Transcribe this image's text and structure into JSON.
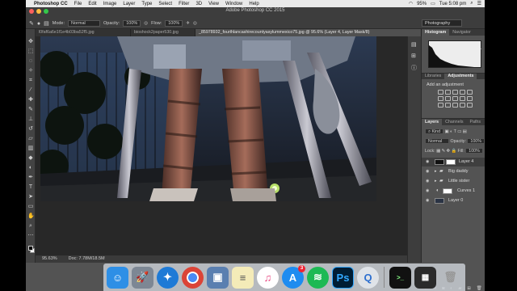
{
  "menubar": {
    "app_name": "Photoshop CC",
    "items": [
      "File",
      "Edit",
      "Image",
      "Layer",
      "Type",
      "Select",
      "Filter",
      "3D",
      "View",
      "Window",
      "Help"
    ],
    "battery": "95%",
    "time": "Tue 5:08 pm"
  },
  "window": {
    "title": "Adobe Photoshop CC 2015"
  },
  "options": {
    "mode_label": "Mode:",
    "mode_value": "Normal",
    "opacity_label": "Opacity:",
    "opacity_value": "100%",
    "flow_label": "Flow:",
    "flow_value": "100%",
    "workspace": "Photography"
  },
  "tabs": [
    {
      "label": "l0faf6a6e1f1e4b03ba52f5.jpg"
    },
    {
      "label": "bioshock2paper530.jpg"
    },
    {
      "label": "_85978932_fourthlancashirecountyasylummexico75.jpg @ 95.6% (Layer 4, Layer Mask/8)"
    }
  ],
  "status": {
    "zoom": "95.63%",
    "doc": "Doc: 7.78M/18.5M"
  },
  "panels": {
    "histogram_tab": "Histogram",
    "navigator_tab": "Navigator",
    "libraries_tab": "Libraries",
    "adjustments_tab": "Adjustments",
    "add_adjustment": "Add an adjustment",
    "layers_tab": "Layers",
    "channels_tab": "Channels",
    "paths_tab": "Paths",
    "kind": "Kind",
    "blend": "Normal",
    "opacity_label": "Opacity:",
    "opacity": "100%",
    "lock_label": "Lock:",
    "fill_label": "Fill:",
    "fill": "100%"
  },
  "layers": [
    {
      "name": "Layer 4"
    },
    {
      "name": "Big daddy"
    },
    {
      "name": "Little sister"
    },
    {
      "name": "Curves 1"
    },
    {
      "name": "Layer 0"
    }
  ],
  "dock": [
    "Finder",
    "Launchpad",
    "Safari",
    "Chrome",
    "Preview",
    "Notes",
    "iTunes",
    "App Store",
    "Spotify",
    "Photoshop",
    "QuickTime",
    "Terminal",
    "Trash"
  ],
  "dock_badge": "3",
  "colors": {
    "ps_blue": "#31a8ff",
    "spotify": "#1db954"
  }
}
